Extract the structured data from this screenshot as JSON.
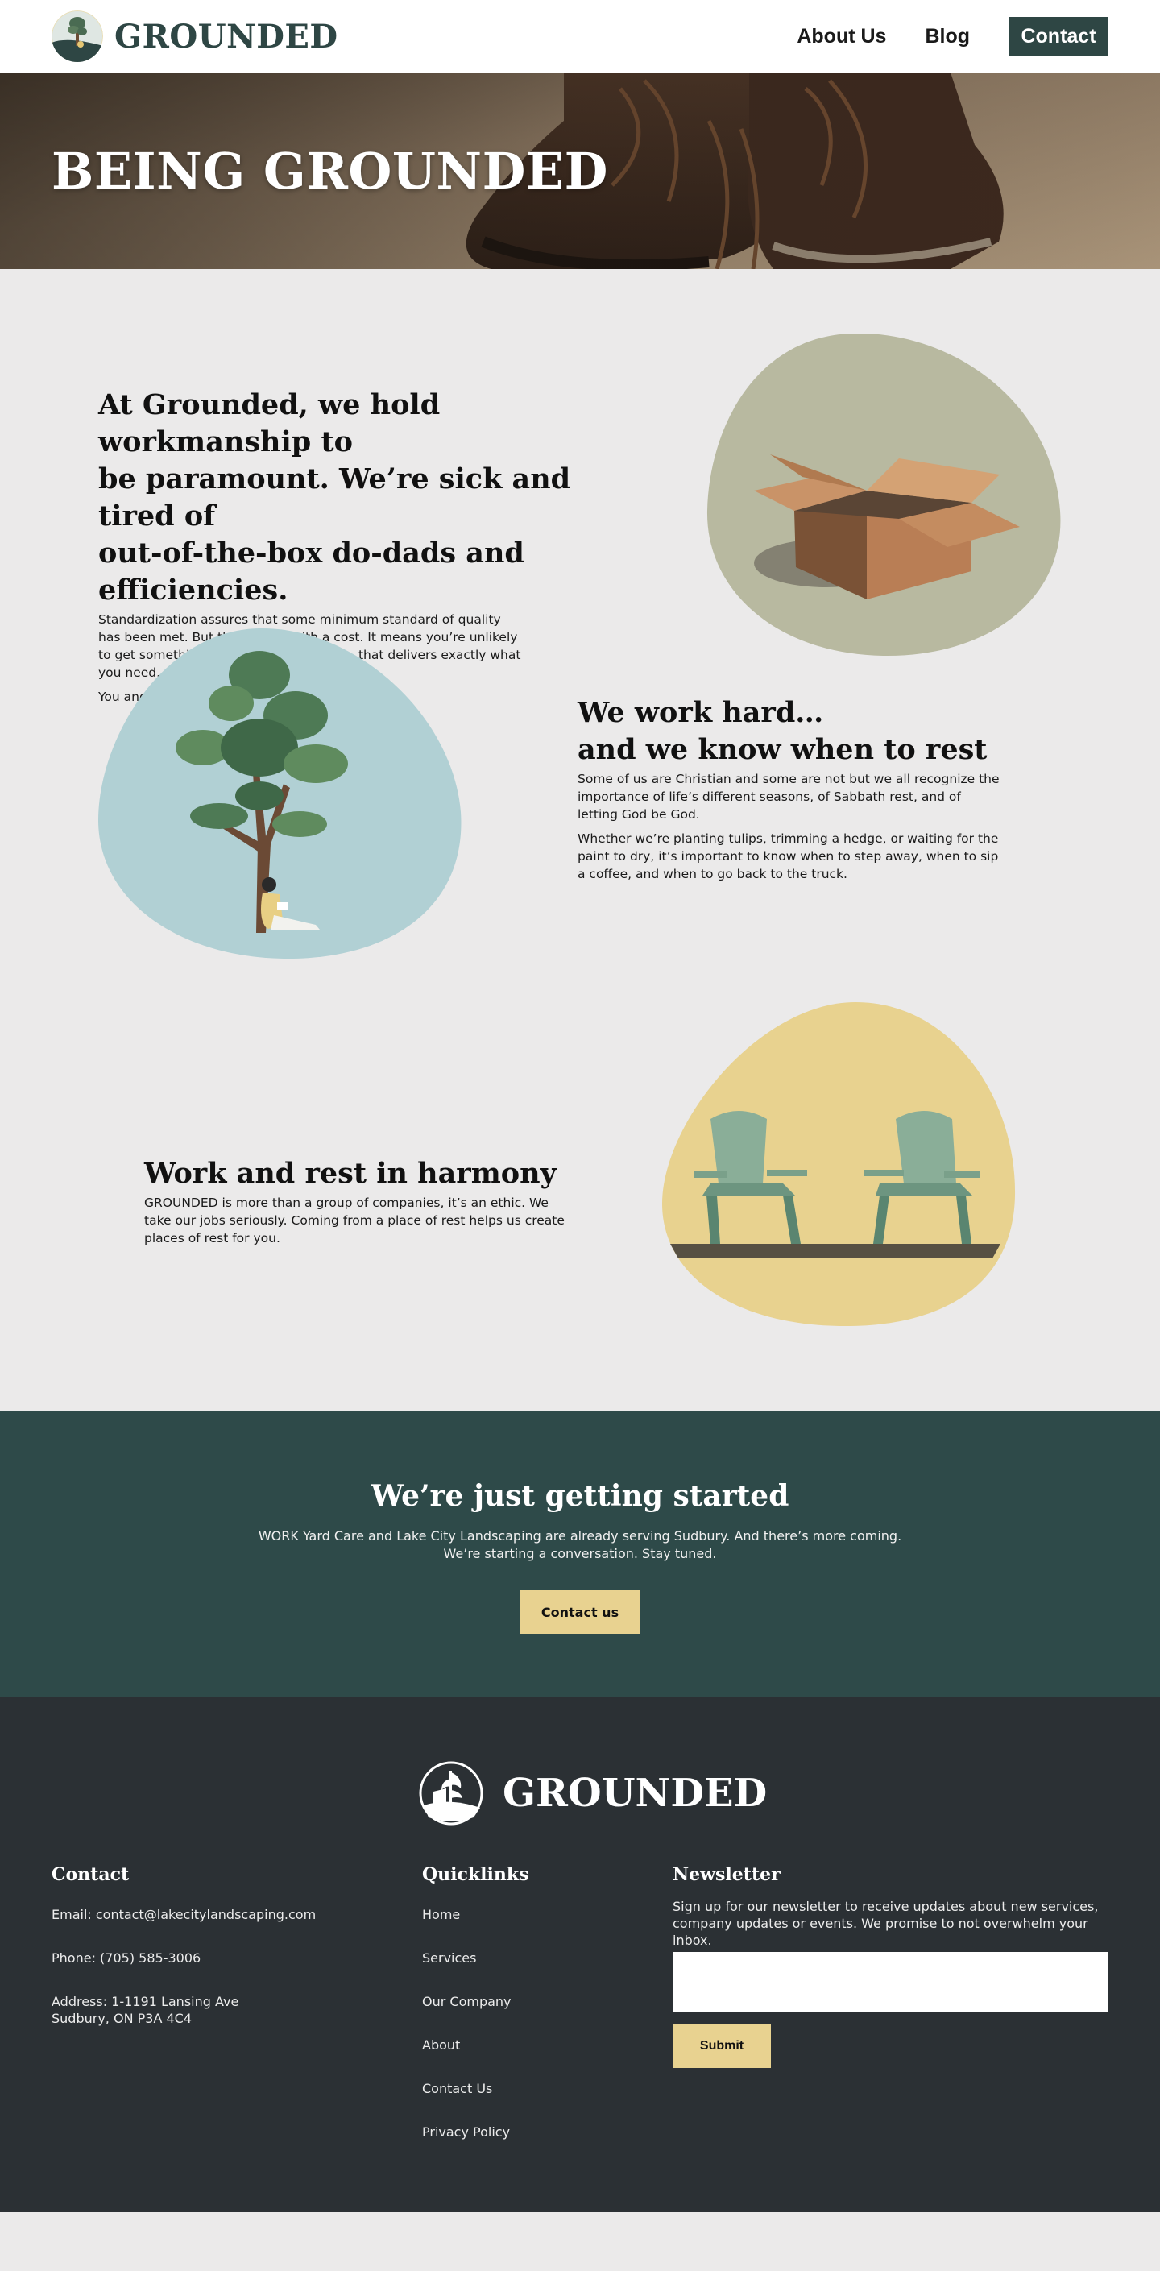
{
  "header": {
    "brand": "GROUNDED",
    "nav": {
      "about": "About Us",
      "blog": "Blog",
      "contact": "Contact"
    }
  },
  "hero": {
    "title": "BEING GROUNDED"
  },
  "section1": {
    "heading_lines": [
      "At Grounded, we hold workmanship to",
      "be paramount. We’re sick and tired of",
      "out-of-the-box do-dads and efficiencies."
    ],
    "p1_lines": [
      "Standardization assures that some minimum standard of quality",
      "has been met. But that comes with a cost. It means you’re unlikely",
      "to get something that is truly excellent…  that delivers exactly what",
      "you need."
    ],
    "p2": "You and your property are not machines."
  },
  "section2": {
    "heading_lines": [
      "We work hard…",
      "and we know when to rest"
    ],
    "p1_lines": [
      "Some of us are Christian and some are not but we all recognize the",
      "importance of life’s different seasons, of Sabbath rest, and of",
      "letting God be God."
    ],
    "p2_lines": [
      "Whether we’re planting tulips, trimming a hedge, or waiting for the",
      "paint to dry, it’s important to know when to step away, when to sip",
      "a coffee, and when to go back to the truck."
    ]
  },
  "section3": {
    "heading": "Work and rest in harmony",
    "p1_lines": [
      "GROUNDED is more than a group of companies, it’s an ethic. We",
      "take our jobs seriously. Coming from a place of rest helps us create",
      "places of rest for you."
    ]
  },
  "cta": {
    "title": "We’re just getting started",
    "text_lines": [
      "WORK Yard Care and Lake City Landscaping are already serving Sudbury. And there’s more coming.",
      "We’re starting a conversation. Stay tuned."
    ],
    "button": "Contact us"
  },
  "footer": {
    "brand": "GROUNDED",
    "contact": {
      "title": "Contact",
      "email": "Email: contact@lakecitylandscaping.com",
      "phone": "Phone: (705) 585-3006",
      "address_lines": [
        "Address: 1-1191 Lansing Ave",
        "Sudbury, ON P3A 4C4"
      ]
    },
    "quicklinks": {
      "title": "Quicklinks",
      "items": [
        "Home",
        "Services",
        "Our Company",
        "About",
        "Contact Us",
        "Privacy Policy"
      ]
    },
    "newsletter": {
      "title": "Newsletter",
      "text_lines": [
        "Sign up for our newsletter to receive updates about new services,",
        "company updates or events. We promise to not overwhelm your inbox."
      ],
      "submit": "Submit"
    }
  },
  "colors": {
    "brand_dark": "#2e4644",
    "cta_band": "#2e4a49",
    "footer_bg": "#2b3034",
    "accent_yellow": "#e8d290",
    "blob_sage": "#b8b9a0",
    "blob_blue": "#b1d0d4",
    "blob_yellow": "#e8d28f"
  },
  "icons": [
    "grounded-logo-icon",
    "boots-photo",
    "open-box-illustration",
    "tree-illustration",
    "adirondack-chairs-illustration"
  ]
}
